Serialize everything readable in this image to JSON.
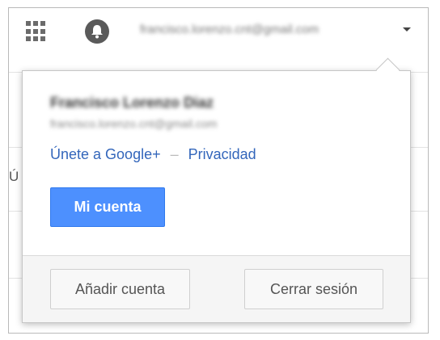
{
  "header": {
    "apps_icon": "apps-grid-icon",
    "notifications_icon": "bell-icon",
    "account_email": "francisco.lorenzo.cnt@gmail.com",
    "dropdown_icon": "caret-down-icon"
  },
  "background": {
    "partial_letter": "Ú"
  },
  "popup": {
    "user_name": "Francisco Lorenzo Diaz",
    "user_email": "francisco.lorenzo.cnt@gmail.com",
    "link_google_plus": "Únete a Google+",
    "separator": "–",
    "link_privacy": "Privacidad",
    "primary_button": "Mi cuenta",
    "footer": {
      "add_account": "Añadir cuenta",
      "sign_out": "Cerrar sesión"
    }
  },
  "colors": {
    "primary": "#4d90fe",
    "link": "#3366bb"
  }
}
